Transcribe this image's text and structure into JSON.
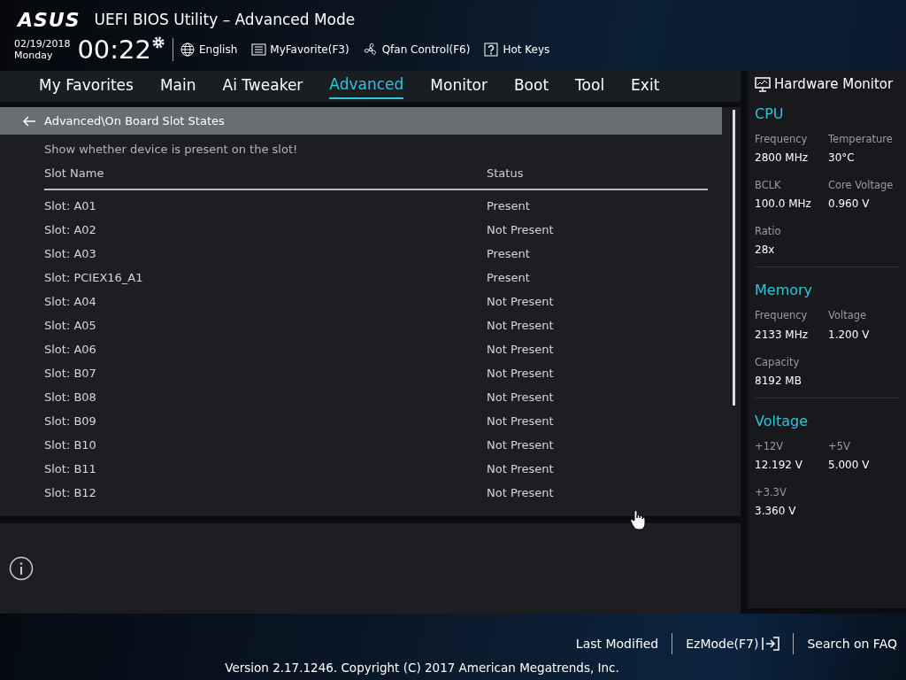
{
  "header": {
    "logo": "ASUS",
    "title": "UEFI BIOS Utility – Advanced Mode",
    "date": "02/19/2018",
    "day": "Monday",
    "time": "00:22",
    "tools": [
      {
        "kind": "globe",
        "label": "English"
      },
      {
        "kind": "favorite",
        "label": "MyFavorite(F3)"
      },
      {
        "kind": "fan",
        "label": "Qfan Control(F6)"
      },
      {
        "kind": "help",
        "label": "Hot Keys"
      }
    ]
  },
  "tabs": [
    {
      "label": "My Favorites",
      "selected": false
    },
    {
      "label": "Main",
      "selected": false
    },
    {
      "label": "Ai Tweaker",
      "selected": false
    },
    {
      "label": "Advanced",
      "selected": true
    },
    {
      "label": "Monitor",
      "selected": false
    },
    {
      "label": "Boot",
      "selected": false
    },
    {
      "label": "Tool",
      "selected": false
    },
    {
      "label": "Exit",
      "selected": false
    }
  ],
  "breadcrumb": "Advanced\\On Board Slot States",
  "description": "Show whether device is present on the slot!",
  "table": {
    "columns": [
      "Slot Name",
      "Status"
    ],
    "rows": [
      [
        "Slot: A01",
        "Present"
      ],
      [
        "Slot: A02",
        "Not Present"
      ],
      [
        "Slot: A03",
        "Present"
      ],
      [
        "Slot: PCIEX16_A1",
        "Present"
      ],
      [
        "Slot: A04",
        "Not Present"
      ],
      [
        "Slot: A05",
        "Not Present"
      ],
      [
        "Slot: A06",
        "Not Present"
      ],
      [
        "Slot: B07",
        "Not Present"
      ],
      [
        "Slot: B08",
        "Not Present"
      ],
      [
        "Slot: B09",
        "Not Present"
      ],
      [
        "Slot: B10",
        "Not Present"
      ],
      [
        "Slot: B11",
        "Not Present"
      ],
      [
        "Slot: B12",
        "Not Present"
      ]
    ]
  },
  "hardware_monitor": {
    "title": "Hardware Monitor",
    "sections": [
      {
        "title": "CPU",
        "items": [
          {
            "label": "Frequency",
            "value": "2800 MHz"
          },
          {
            "label": "Temperature",
            "value": "30°C"
          },
          {
            "label": "BCLK",
            "value": "100.0 MHz"
          },
          {
            "label": "Core Voltage",
            "value": "0.960 V"
          },
          {
            "label": "Ratio",
            "value": "28x"
          }
        ]
      },
      {
        "title": "Memory",
        "items": [
          {
            "label": "Frequency",
            "value": "2133 MHz"
          },
          {
            "label": "Voltage",
            "value": "1.200 V"
          },
          {
            "label": "Capacity",
            "value": "8192 MB"
          }
        ]
      },
      {
        "title": "Voltage",
        "items": [
          {
            "label": "+12V",
            "value": "12.192 V"
          },
          {
            "label": "+5V",
            "value": "5.000 V"
          },
          {
            "label": "+3.3V",
            "value": "3.360 V"
          }
        ]
      }
    ]
  },
  "footer": {
    "links": [
      {
        "kind": "plain",
        "label": "Last Modified"
      },
      {
        "kind": "exit",
        "label": "EzMode(F7)"
      },
      {
        "kind": "plain",
        "label": "Search on FAQ"
      }
    ],
    "version": "Version 2.17.1246. Copyright (C) 2017 American Megatrends, Inc."
  }
}
